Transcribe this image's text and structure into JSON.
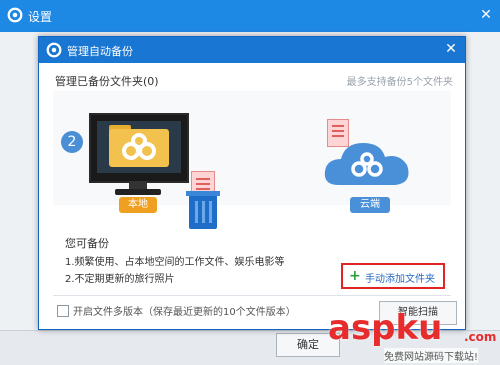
{
  "outer_window": {
    "title": "设置",
    "ok_label": "确定"
  },
  "dialog": {
    "title": "管理自动备份",
    "managed_folders": "管理已备份文件夹(0)",
    "max_support": "最多支持备份5个文件夹",
    "step_number": "2",
    "local_label": "本地",
    "cloud_label": "云端",
    "can_backup_heading": "您可备份",
    "can_backup_item1": "1.频繁使用、占本地空间的工作文件、娱乐电影等",
    "can_backup_item2": "2.不定期更新的旅行照片",
    "add_folder_button": "手动添加文件夹",
    "multi_version_checkbox": "开启文件多版本（保存最近更新的10个文件版本）",
    "smart_button": "智能扫描"
  },
  "watermark": {
    "brand": "aspku",
    "suffix": ".com",
    "tagline": "免费网站源码下载站!"
  },
  "colors": {
    "title_bar": "#1976d2",
    "accent_red": "#e02424",
    "folder_yellow": "#f2c14e",
    "cloud_blue": "#4a90d9"
  }
}
